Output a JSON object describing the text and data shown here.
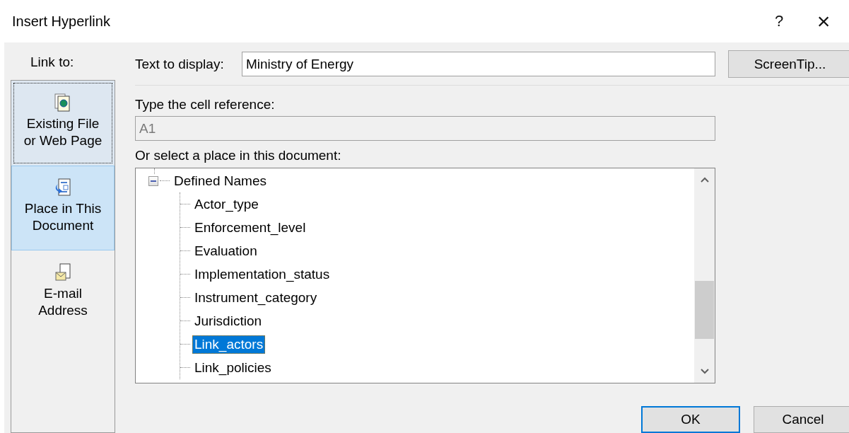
{
  "window": {
    "title": "Insert Hyperlink",
    "help": "?",
    "close": "×"
  },
  "link_to": {
    "label": "Link to:",
    "items": [
      {
        "kind": "file",
        "lines": [
          "Existing File",
          "or Web Page"
        ],
        "selected": false,
        "focused": true
      },
      {
        "kind": "place",
        "lines": [
          "Place in This",
          "Document"
        ],
        "selected": true,
        "focused": false
      },
      {
        "kind": "email",
        "lines": [
          "E-mail",
          "Address"
        ],
        "selected": false,
        "focused": false
      }
    ]
  },
  "text_to_display": {
    "label": "Text to display:",
    "value": "Ministry of Energy"
  },
  "screentip_button": "ScreenTip...",
  "cell_reference": {
    "label": "Type the cell reference:",
    "value": "A1",
    "disabled": true
  },
  "place": {
    "label": "Or select a place in this document:",
    "tree": [
      {
        "label": "Defined Names",
        "expanded": true,
        "children": [
          {
            "label": "Actor_type",
            "selected": false
          },
          {
            "label": "Enforcement_level",
            "selected": false
          },
          {
            "label": "Evaluation",
            "selected": false
          },
          {
            "label": "Implementation_status",
            "selected": false
          },
          {
            "label": "Instrument_category",
            "selected": false
          },
          {
            "label": "Jurisdiction",
            "selected": false
          },
          {
            "label": "Link_actors",
            "selected": true
          },
          {
            "label": "Link_policies",
            "selected": false
          }
        ]
      }
    ]
  },
  "buttons": [
    {
      "label": "OK",
      "default": true
    },
    {
      "label": "Cancel",
      "default": false
    }
  ]
}
